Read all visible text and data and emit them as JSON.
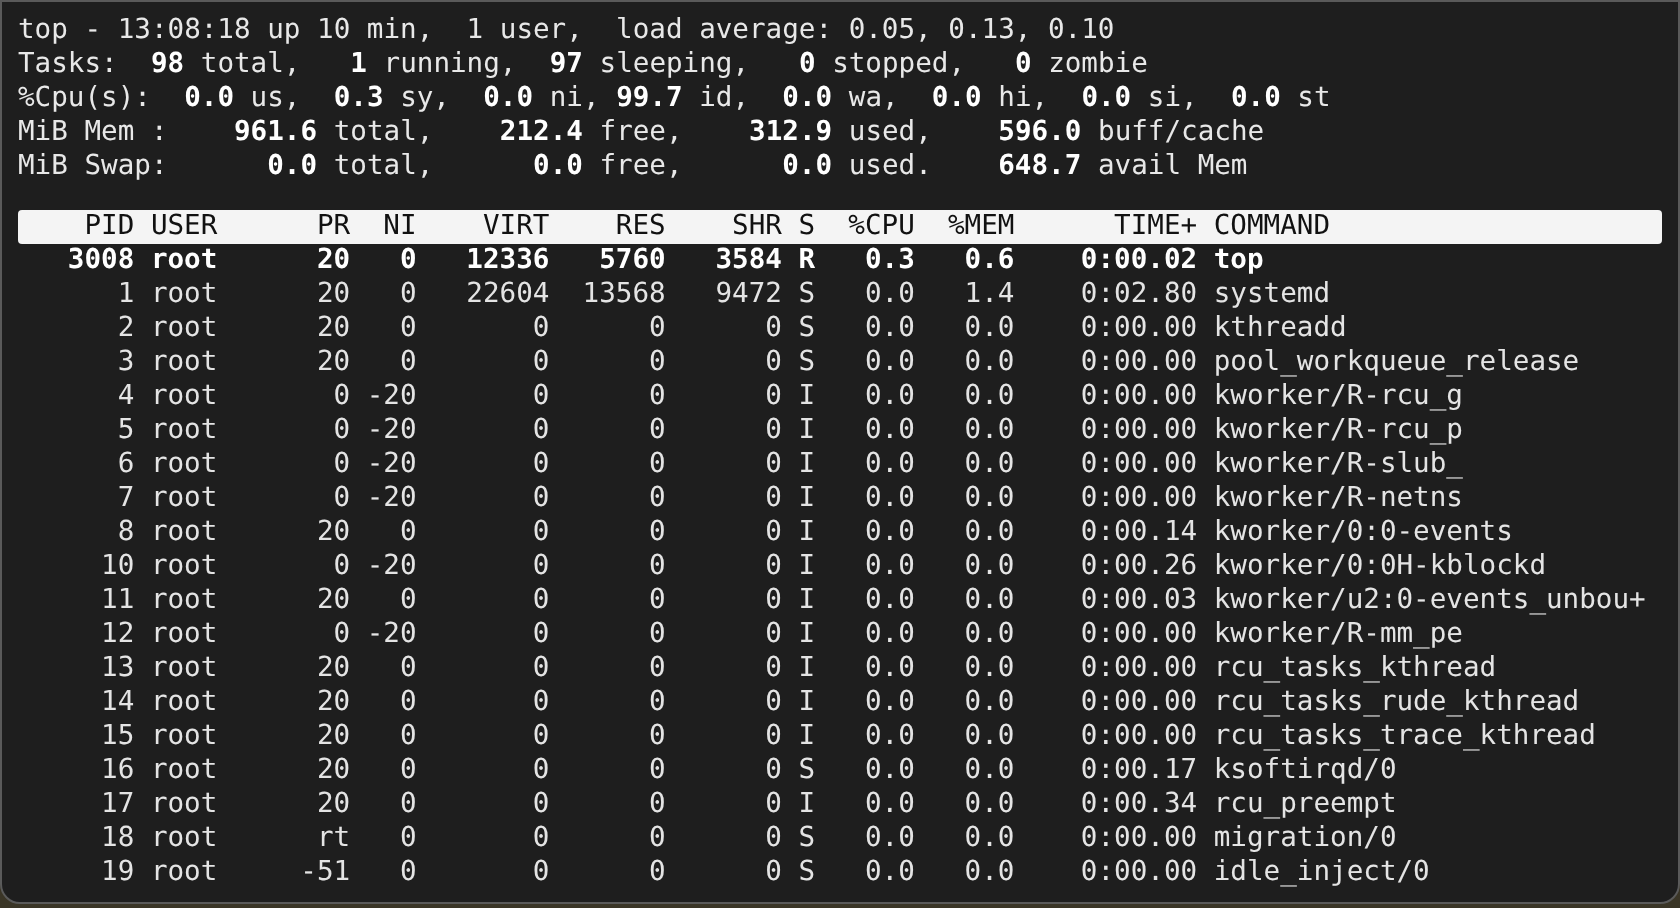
{
  "summary": [
    "top - 13:08:18 up 10 min,  1 user,  load average: 0.05, 0.13, 0.10",
    "Tasks:  **98** total,   **1** running,  **97** sleeping,   **0** stopped,   **0** zombie",
    "%Cpu(s):  **0.0** us,  **0.3** sy,  **0.0** ni, **99.7** id,  **0.0** wa,  **0.0** hi,  **0.0** si,  **0.0** st",
    "MiB Mem :    **961.6** total,    **212.4** free,    **312.9** used,    **596.0** buff/cache",
    "MiB Swap:      **0.0** total,      **0.0** free,      **0.0** used.    **648.7** avail Mem"
  ],
  "table": {
    "columns": [
      "PID",
      "USER",
      "PR",
      "NI",
      "VIRT",
      "RES",
      "SHR",
      "S",
      "%CPU",
      "%MEM",
      "TIME+",
      "COMMAND"
    ],
    "rows": [
      {
        "cells": [
          "3008",
          "root",
          "20",
          "0",
          "12336",
          "5760",
          "3584",
          "R",
          "0.3",
          "0.6",
          "0:00.02",
          "top"
        ],
        "highlighted": true
      },
      {
        "cells": [
          "1",
          "root",
          "20",
          "0",
          "22604",
          "13568",
          "9472",
          "S",
          "0.0",
          "1.4",
          "0:02.80",
          "systemd"
        ],
        "highlighted": false
      },
      {
        "cells": [
          "2",
          "root",
          "20",
          "0",
          "0",
          "0",
          "0",
          "S",
          "0.0",
          "0.0",
          "0:00.00",
          "kthreadd"
        ],
        "highlighted": false
      },
      {
        "cells": [
          "3",
          "root",
          "20",
          "0",
          "0",
          "0",
          "0",
          "S",
          "0.0",
          "0.0",
          "0:00.00",
          "pool_workqueue_release"
        ],
        "highlighted": false
      },
      {
        "cells": [
          "4",
          "root",
          "0",
          "-20",
          "0",
          "0",
          "0",
          "I",
          "0.0",
          "0.0",
          "0:00.00",
          "kworker/R-rcu_g"
        ],
        "highlighted": false
      },
      {
        "cells": [
          "5",
          "root",
          "0",
          "-20",
          "0",
          "0",
          "0",
          "I",
          "0.0",
          "0.0",
          "0:00.00",
          "kworker/R-rcu_p"
        ],
        "highlighted": false
      },
      {
        "cells": [
          "6",
          "root",
          "0",
          "-20",
          "0",
          "0",
          "0",
          "I",
          "0.0",
          "0.0",
          "0:00.00",
          "kworker/R-slub_"
        ],
        "highlighted": false
      },
      {
        "cells": [
          "7",
          "root",
          "0",
          "-20",
          "0",
          "0",
          "0",
          "I",
          "0.0",
          "0.0",
          "0:00.00",
          "kworker/R-netns"
        ],
        "highlighted": false
      },
      {
        "cells": [
          "8",
          "root",
          "20",
          "0",
          "0",
          "0",
          "0",
          "I",
          "0.0",
          "0.0",
          "0:00.14",
          "kworker/0:0-events"
        ],
        "highlighted": false
      },
      {
        "cells": [
          "10",
          "root",
          "0",
          "-20",
          "0",
          "0",
          "0",
          "I",
          "0.0",
          "0.0",
          "0:00.26",
          "kworker/0:0H-kblockd"
        ],
        "highlighted": false
      },
      {
        "cells": [
          "11",
          "root",
          "20",
          "0",
          "0",
          "0",
          "0",
          "I",
          "0.0",
          "0.0",
          "0:00.03",
          "kworker/u2:0-events_unbou+"
        ],
        "highlighted": false
      },
      {
        "cells": [
          "12",
          "root",
          "0",
          "-20",
          "0",
          "0",
          "0",
          "I",
          "0.0",
          "0.0",
          "0:00.00",
          "kworker/R-mm_pe"
        ],
        "highlighted": false
      },
      {
        "cells": [
          "13",
          "root",
          "20",
          "0",
          "0",
          "0",
          "0",
          "I",
          "0.0",
          "0.0",
          "0:00.00",
          "rcu_tasks_kthread"
        ],
        "highlighted": false
      },
      {
        "cells": [
          "14",
          "root",
          "20",
          "0",
          "0",
          "0",
          "0",
          "I",
          "0.0",
          "0.0",
          "0:00.00",
          "rcu_tasks_rude_kthread"
        ],
        "highlighted": false
      },
      {
        "cells": [
          "15",
          "root",
          "20",
          "0",
          "0",
          "0",
          "0",
          "I",
          "0.0",
          "0.0",
          "0:00.00",
          "rcu_tasks_trace_kthread"
        ],
        "highlighted": false
      },
      {
        "cells": [
          "16",
          "root",
          "20",
          "0",
          "0",
          "0",
          "0",
          "S",
          "0.0",
          "0.0",
          "0:00.17",
          "ksoftirqd/0"
        ],
        "highlighted": false
      },
      {
        "cells": [
          "17",
          "root",
          "20",
          "0",
          "0",
          "0",
          "0",
          "I",
          "0.0",
          "0.0",
          "0:00.34",
          "rcu_preempt"
        ],
        "highlighted": false
      },
      {
        "cells": [
          "18",
          "root",
          "rt",
          "0",
          "0",
          "0",
          "0",
          "S",
          "0.0",
          "0.0",
          "0:00.00",
          "migration/0"
        ],
        "highlighted": false
      },
      {
        "cells": [
          "19",
          "root",
          "-51",
          "0",
          "0",
          "0",
          "0",
          "S",
          "0.0",
          "0.0",
          "0:00.00",
          "idle_inject/0"
        ],
        "highlighted": false
      }
    ]
  }
}
